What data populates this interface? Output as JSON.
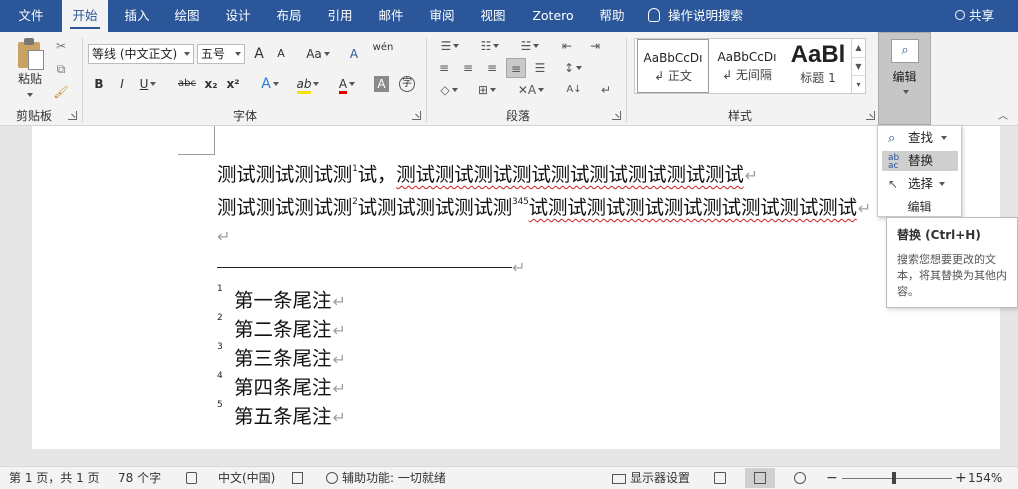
{
  "tabs": [
    {
      "label": "文件",
      "active": false
    },
    {
      "label": "开始",
      "active": true
    },
    {
      "label": "插入",
      "active": false
    },
    {
      "label": "绘图",
      "active": false
    },
    {
      "label": "设计",
      "active": false
    },
    {
      "label": "布局",
      "active": false
    },
    {
      "label": "引用",
      "active": false
    },
    {
      "label": "邮件",
      "active": false
    },
    {
      "label": "审阅",
      "active": false
    },
    {
      "label": "视图",
      "active": false
    },
    {
      "label": "Zotero",
      "active": false
    },
    {
      "label": "帮助",
      "active": false
    }
  ],
  "tell_me": "操作说明搜索",
  "share": "共享",
  "ribbon": {
    "clipboard": {
      "paste": "粘贴",
      "label": "剪贴板"
    },
    "font": {
      "name": "等线 (中文正文)",
      "size": "五号",
      "label": "字体",
      "grow": "A",
      "shrink": "A",
      "case": "Aa",
      "bold": "B",
      "italic": "I",
      "underline": "U",
      "strike": "abc",
      "subscript": "x₂",
      "superscript": "x²",
      "effects": "A",
      "highlight": "ab",
      "color": "A",
      "shade": "A",
      "enclose": "字",
      "clear": "A",
      "phonetic": "wén"
    },
    "paragraph": {
      "label": "段落"
    },
    "styles": {
      "label": "样式",
      "items": [
        {
          "sample": "AaBbCcDı",
          "name": "↲ 正文",
          "selected": true
        },
        {
          "sample": "AaBbCcDı",
          "name": "↲ 无间隔",
          "selected": false
        },
        {
          "sample": "AaBl",
          "name": "标题 1",
          "selected": false
        }
      ]
    },
    "editing": {
      "label": "编辑"
    }
  },
  "document": {
    "line1": {
      "a": "测试测试测试测",
      "sup1": "1",
      "b": "试，",
      "c": "测试测试测试测试测试测试测试测试测试"
    },
    "line2": {
      "a": "测试测试测试测",
      "sup1": "2",
      "b": "试测试测试测试测",
      "sup2": "345",
      "c": "试测试测试测试测试测试测试测试测试"
    },
    "para_mark": "↵",
    "endnotes": [
      {
        "num": "1",
        "text": "第一条尾注"
      },
      {
        "num": "2",
        "text": "第二条尾注"
      },
      {
        "num": "3",
        "text": "第三条尾注"
      },
      {
        "num": "4",
        "text": "第四条尾注"
      },
      {
        "num": "5",
        "text": "第五条尾注"
      }
    ]
  },
  "edit_menu": {
    "find": "查找",
    "replace": "替换",
    "select": "选择",
    "label": "编辑",
    "highlighted": "替换"
  },
  "tooltip": {
    "title": "替换 (Ctrl+H)",
    "description": "搜索您想要更改的文本，将其替换为其他内容。"
  },
  "status": {
    "page": "第 1 页，共 1 页",
    "words": "78 个字",
    "language": "中文(中国)",
    "accessibility": "辅助功能: 一切就绪",
    "display": "显示器设置",
    "zoom": "154%",
    "minus": "−",
    "plus": "+"
  },
  "colors": {
    "accent": "#2b579a",
    "spell_error": "#d02020"
  }
}
